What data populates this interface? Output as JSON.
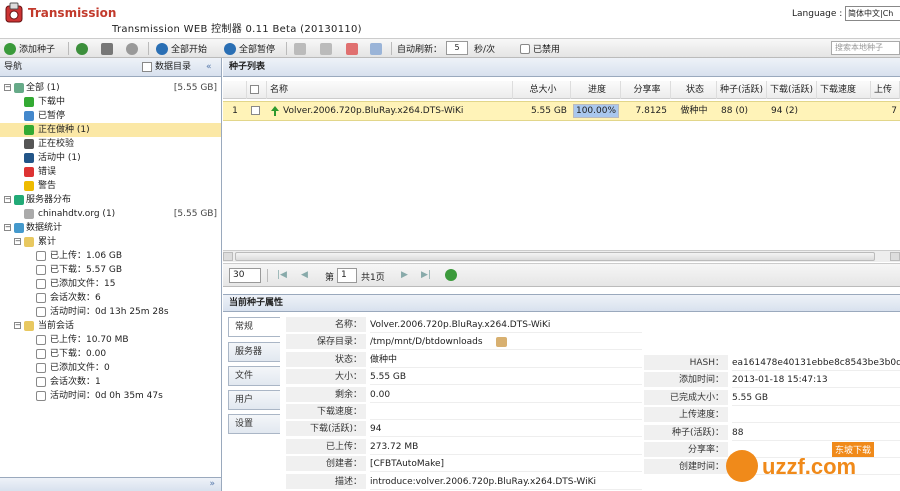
{
  "header": {
    "app_name": "Transmission",
    "subtitle": "Transmission WEB 控制器 0.11 Beta (20130110)",
    "language_label": "Language :",
    "language_value": "简体中文|Ch"
  },
  "toolbar": {
    "add_torrent": "添加种子",
    "start_all": "全部开始",
    "pause_all": "全部暂停",
    "auto_refresh_label": "自动刷新：",
    "refresh_value": "5",
    "refresh_unit": "秒/次",
    "disabled_label": "已禁用",
    "search_placeholder": "搜索本地种子"
  },
  "sidebar": {
    "title": "导航",
    "data_dir_label": "数据目录",
    "collapse_icon": "«",
    "items": [
      {
        "label": "全部 (1)",
        "size": "[5.55 GB]"
      },
      {
        "label": "下载中"
      },
      {
        "label": "已暂停"
      },
      {
        "label": "正在做种 (1)"
      },
      {
        "label": "正在校验"
      },
      {
        "label": "活动中 (1)"
      },
      {
        "label": "错误"
      },
      {
        "label": "警告"
      },
      {
        "label": "服务器分布"
      },
      {
        "label": "chinahdtv.org (1)",
        "size": "[5.55 GB]"
      },
      {
        "label": "数据统计"
      },
      {
        "label": "累计"
      },
      {
        "label": "已上传：1.06 GB"
      },
      {
        "label": "已下载：5.57 GB"
      },
      {
        "label": "已添加文件：15"
      },
      {
        "label": "会话次数：6"
      },
      {
        "label": "活动时间：0d 13h 25m 28s"
      },
      {
        "label": "当前会话"
      },
      {
        "label": "已上传：10.70 MB"
      },
      {
        "label": "已下载：0.00"
      },
      {
        "label": "已添加文件：0"
      },
      {
        "label": "会话次数：1"
      },
      {
        "label": "活动时间：0d 0h 35m 47s"
      }
    ],
    "footer_icon": "»"
  },
  "torrent_list": {
    "title": "种子列表",
    "columns": [
      "名称",
      "总大小",
      "进度",
      "分享率",
      "状态",
      "种子(活跃)",
      "下载(活跃)",
      "下载速度",
      "上传"
    ],
    "rows": [
      {
        "index": "1",
        "name": "Volver.2006.720p.BluRay.x264.DTS-WiKi",
        "size": "5.55 GB",
        "progress": "100.00%",
        "progress_fraction": 1.0,
        "ratio": "7.8125",
        "status": "做种中",
        "seeds": "88 (0)",
        "peers": "94 (2)",
        "dl_speed": "",
        "ul": "7"
      }
    ]
  },
  "pager": {
    "page_size": "30",
    "page_label": "第",
    "page_value": "1",
    "total_label": "共1页"
  },
  "details": {
    "title": "当前种子属性",
    "tabs": [
      "常规",
      "服务器",
      "文件",
      "用户",
      "设置"
    ],
    "left_fields": [
      {
        "label": "名称：",
        "value": "Volver.2006.720p.BluRay.x264.DTS-WiKi"
      },
      {
        "label": "保存目录：",
        "value": "/tmp/mnt/D/btdownloads"
      },
      {
        "label": "状态：",
        "value": "做种中"
      },
      {
        "label": "大小：",
        "value": "5.55 GB"
      },
      {
        "label": "剩余：",
        "value": "0.00"
      },
      {
        "label": "下载速度：",
        "value": ""
      },
      {
        "label": "下载(活跃)：",
        "value": "94"
      },
      {
        "label": "已上传：",
        "value": "273.72 MB"
      },
      {
        "label": "创建者：",
        "value": "[CFBTAutoMake]"
      },
      {
        "label": "描述：",
        "value": "introduce:volver.2006.720p.BluRay.x264.DTS-WiKi"
      }
    ],
    "right_fields": [
      {
        "label": "HASH：",
        "value": "ea161478e40131ebbe8c8543be3b0dc"
      },
      {
        "label": "添加时间：",
        "value": "2013-01-18 15:47:13"
      },
      {
        "label": "已完成大小：",
        "value": "5.55 GB"
      },
      {
        "label": "上传速度：",
        "value": ""
      },
      {
        "label": "种子(活跃)：",
        "value": "88"
      },
      {
        "label": "分享率：",
        "value": ""
      },
      {
        "label": "创建时间：",
        "value": ""
      }
    ]
  },
  "watermark": {
    "text": "uzzf.com",
    "sub": "东坡下载"
  }
}
